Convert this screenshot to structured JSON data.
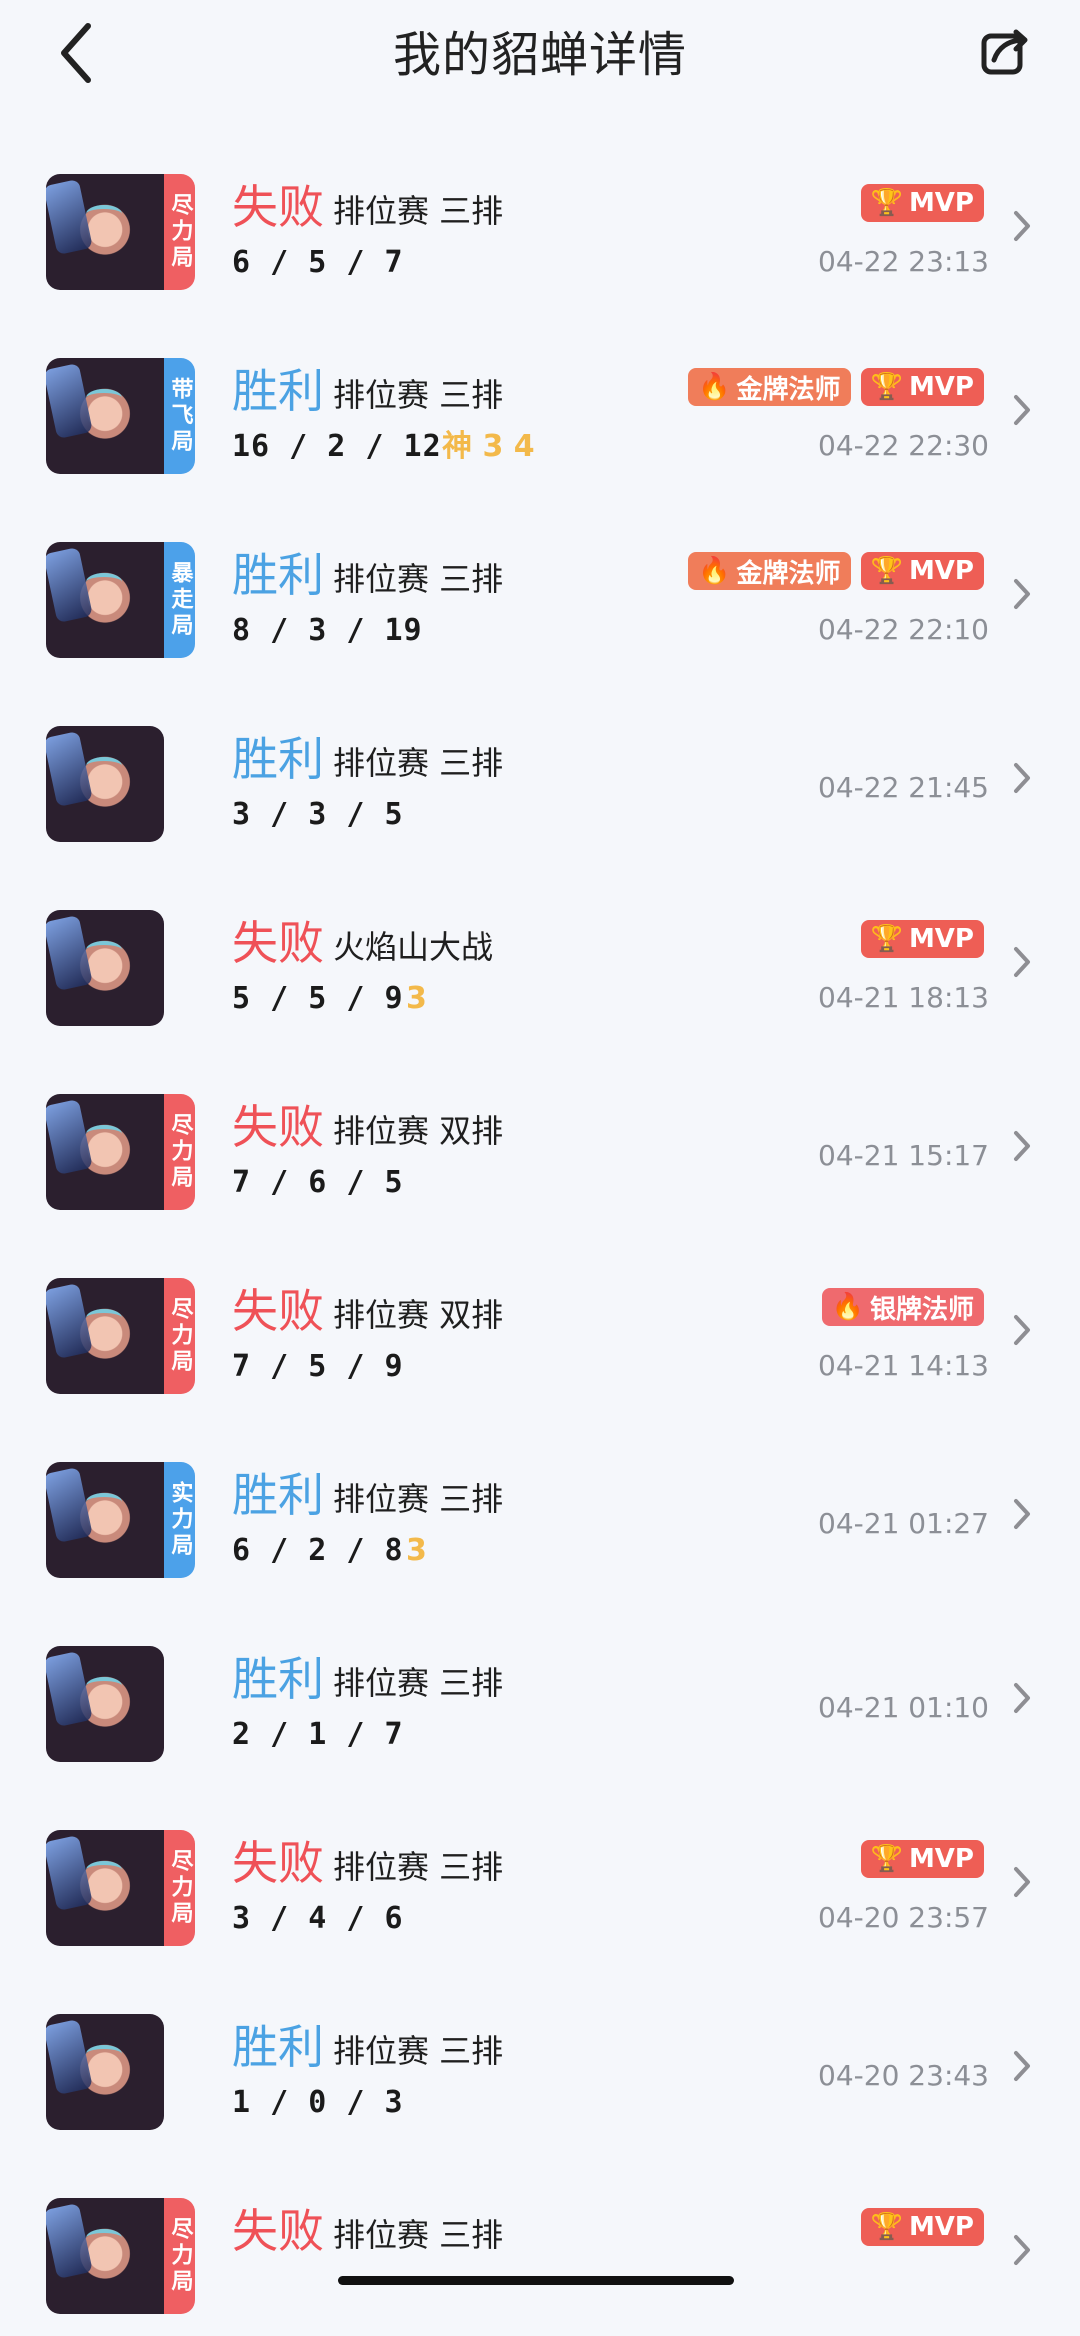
{
  "header": {
    "title": "我的貂蝉详情",
    "back_icon": "back-chevron-icon",
    "share_icon": "share-icon"
  },
  "colors": {
    "win": "#4ba2e3",
    "lose": "#ef5157",
    "tag_red": "#ef5f62",
    "tag_blue": "#4ca1ea",
    "streak": "#f3b94a",
    "background": "#f5f7fb"
  },
  "matches": [
    {
      "result": "失败",
      "outcome": "lose",
      "mode": "排位赛 三排",
      "kda": "6 / 5 / 7",
      "streak": "",
      "tag": "尽力局",
      "tag_color": "red",
      "badges": [
        "MVP"
      ],
      "time": "04-22 23:13"
    },
    {
      "result": "胜利",
      "outcome": "win",
      "mode": "排位赛 三排",
      "kda": "16 / 2 / 12",
      "streak": "神 3 4",
      "tag": "带飞局",
      "tag_color": "blue",
      "badges": [
        "金牌法师",
        "MVP"
      ],
      "time": "04-22 22:30"
    },
    {
      "result": "胜利",
      "outcome": "win",
      "mode": "排位赛 三排",
      "kda": "8 / 3 / 19",
      "streak": "",
      "tag": "暴走局",
      "tag_color": "blue",
      "badges": [
        "金牌法师",
        "MVP"
      ],
      "time": "04-22 22:10"
    },
    {
      "result": "胜利",
      "outcome": "win",
      "mode": "排位赛 三排",
      "kda": "3 / 3 / 5",
      "streak": "",
      "tag": "",
      "tag_color": "",
      "badges": [],
      "time": "04-22 21:45"
    },
    {
      "result": "失败",
      "outcome": "lose",
      "mode": "火焰山大战",
      "kda": "5 / 5 / 9",
      "streak": "3",
      "tag": "",
      "tag_color": "",
      "badges": [
        "MVP"
      ],
      "time": "04-21 18:13"
    },
    {
      "result": "失败",
      "outcome": "lose",
      "mode": "排位赛 双排",
      "kda": "7 / 6 / 5",
      "streak": "",
      "tag": "尽力局",
      "tag_color": "red",
      "badges": [],
      "time": "04-21 15:17"
    },
    {
      "result": "失败",
      "outcome": "lose",
      "mode": "排位赛 双排",
      "kda": "7 / 5 / 9",
      "streak": "",
      "tag": "尽力局",
      "tag_color": "red",
      "badges": [
        "银牌法师"
      ],
      "time": "04-21 14:13"
    },
    {
      "result": "胜利",
      "outcome": "win",
      "mode": "排位赛 三排",
      "kda": "6 / 2 / 8",
      "streak": "3",
      "tag": "实力局",
      "tag_color": "blue",
      "badges": [],
      "time": "04-21 01:27"
    },
    {
      "result": "胜利",
      "outcome": "win",
      "mode": "排位赛 三排",
      "kda": "2 / 1 / 7",
      "streak": "",
      "tag": "",
      "tag_color": "",
      "badges": [],
      "time": "04-21 01:10"
    },
    {
      "result": "失败",
      "outcome": "lose",
      "mode": "排位赛 三排",
      "kda": "3 / 4 / 6",
      "streak": "",
      "tag": "尽力局",
      "tag_color": "red",
      "badges": [
        "MVP"
      ],
      "time": "04-20 23:57"
    },
    {
      "result": "胜利",
      "outcome": "win",
      "mode": "排位赛 三排",
      "kda": "1 / 0 / 3",
      "streak": "",
      "tag": "",
      "tag_color": "",
      "badges": [],
      "time": "04-20 23:43"
    },
    {
      "result": "失败",
      "outcome": "lose",
      "mode": "排位赛 三排",
      "kda": "",
      "streak": "",
      "tag": "尽力局",
      "tag_color": "red",
      "badges": [
        "MVP"
      ],
      "time": ""
    }
  ]
}
